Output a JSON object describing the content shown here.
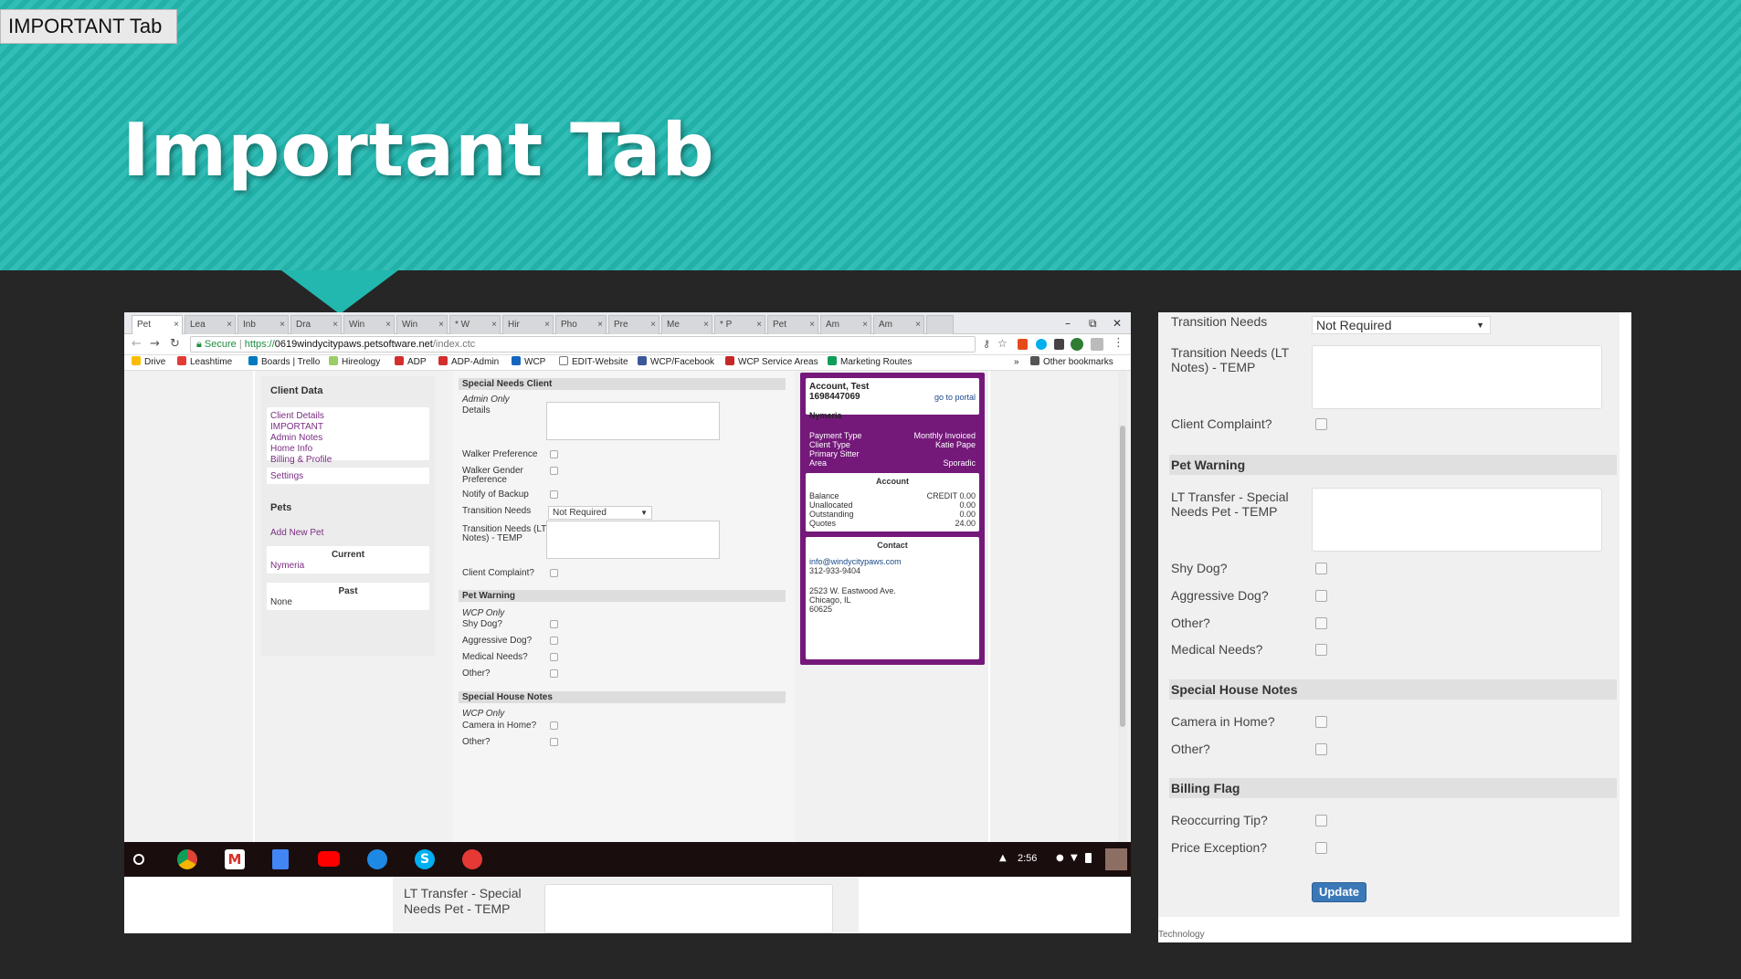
{
  "slide": {
    "tag": "IMPORTANT Tab",
    "title": "Important Tab",
    "colors": {
      "teal": "#22b8b0",
      "dark": "#262626",
      "purple": "#74197a"
    }
  },
  "browser": {
    "tabs": [
      "Pet",
      "Lea",
      "Inb",
      "Dra",
      "Win",
      "Win",
      "* W",
      "Hir",
      "Pho",
      "Pre",
      "Me",
      "* P",
      "Pet",
      "Am",
      "Am"
    ],
    "url_secure": "Secure",
    "url_prefix": "https://",
    "url_host": "0619windycitypaws.petsoftware.net",
    "url_path": "/index.ctc",
    "bookmarks": [
      "Drive",
      "Leashtime",
      "Boards | Trello",
      "Hireology",
      "ADP",
      "ADP-Admin",
      "WCP",
      "EDIT-Website",
      "WCP/Facebook",
      "WCP Service Areas",
      "Marketing Routes"
    ],
    "more_bookmarks": "»",
    "other_bookmarks": "Other bookmarks",
    "window_controls": [
      "–",
      "⧉",
      "✕"
    ]
  },
  "client_nav": {
    "title": "Client Data",
    "links": [
      "Client Details",
      "IMPORTANT",
      "Admin Notes",
      "Home Info",
      "Billing & Profile"
    ],
    "settings": "Settings",
    "pets_title": "Pets",
    "add_pet": "Add New Pet",
    "current_label": "Current",
    "current_pet": "Nymeria",
    "past_label": "Past",
    "past_value": "None"
  },
  "form": {
    "special_needs_header": "Special Needs Client",
    "admin_only": "Admin Only",
    "details": "Details",
    "walker_preference": "Walker Preference",
    "walker_gender": "Walker Gender",
    "walker_gender_2": "Preference",
    "notify_backup": "Notify of Backup",
    "transition_needs": "Transition Needs",
    "transition_value": "Not Required",
    "transition_lt": "Transition Needs (LT",
    "transition_lt_2": "Notes) - TEMP",
    "client_complaint": "Client Complaint?",
    "pet_warning_header": "Pet Warning",
    "wcp_only": "WCP Only",
    "shy_dog": "Shy Dog?",
    "aggressive_dog": "Aggressive Dog?",
    "medical_needs": "Medical Needs?",
    "other": "Other?",
    "house_notes_header": "Special House Notes",
    "wcp_only_2": "WCP Only",
    "camera": "Camera in Home?",
    "other_2": "Other?"
  },
  "account": {
    "name": "Account, Test",
    "number": "1698447069",
    "portal": "go to portal",
    "pet": "Nymeria",
    "payment_type_label": "Payment Type",
    "payment_type": "Monthly Invoiced",
    "client_type_label": "Client Type",
    "client_type": "Katie Pape",
    "primary_sitter_label": "Primary Sitter",
    "area_label": "Area",
    "area": "Sporadic",
    "account_title": "Account",
    "balance_label": "Balance",
    "balance": "CREDIT 0.00",
    "unallocated_label": "Unallocated",
    "unallocated": "0.00",
    "outstanding_label": "Outstanding",
    "outstanding": "0.00",
    "quotes_label": "Quotes",
    "quotes": "24.00",
    "contact_title": "Contact",
    "email": "info@windycitypaws.com",
    "phone": "312-933-9404",
    "address1": "2523 W. Eastwood Ave.",
    "address2": "Chicago, IL",
    "zip": "60625"
  },
  "taskbar": {
    "time": "2:56"
  },
  "bottom_strip": {
    "lt_transfer": "LT Transfer - Special",
    "lt_transfer_2": "Needs Pet - TEMP"
  },
  "right_form": {
    "transition_needs": "Transition Needs",
    "transition_value": "Not Required",
    "transition_lt": "Transition Needs (LT",
    "transition_lt_2": "Notes) - TEMP",
    "client_complaint": "Client Complaint?",
    "pet_warning": "Pet Warning",
    "lt_transfer": "LT Transfer - Special",
    "lt_transfer_2": "Needs Pet - TEMP",
    "shy_dog": "Shy Dog?",
    "aggressive_dog": "Aggressive Dog?",
    "other": "Other?",
    "medical_needs": "Medical Needs?",
    "house_notes": "Special House Notes",
    "camera": "Camera in Home?",
    "other_2": "Other?",
    "billing_flag": "Billing Flag",
    "reoccurring_tip": "Reoccurring Tip?",
    "price_exception": "Price Exception?",
    "update": "Update",
    "footer_cut": "Technology"
  }
}
